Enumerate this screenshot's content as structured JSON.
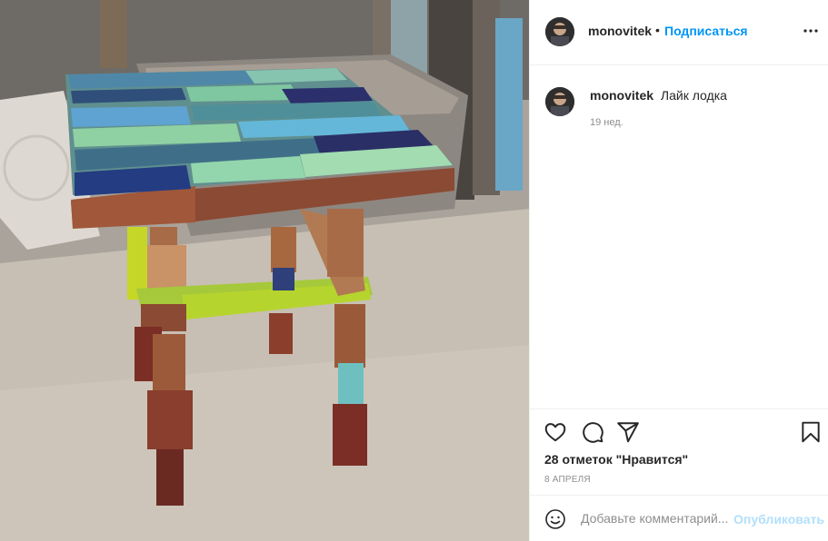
{
  "post": {
    "image_alt": "Table with a multicolored painted wood top and uneven block legs",
    "author": {
      "username": "monovitek",
      "follow_label": "Подписаться",
      "dot": "•"
    },
    "caption": {
      "username": "monovitek",
      "text": "Лайк лодка",
      "time_ago": "19 нед."
    },
    "likes_label": "28 отметок \"Нравится\"",
    "date_label": "8 АПРЕЛЯ",
    "comment": {
      "placeholder": "Добавьте комментарий...",
      "publish_label": "Опубликовать"
    }
  },
  "icons": {
    "more": "more-options-icon",
    "like": "heart-icon",
    "comment": "comment-bubble-icon",
    "share": "paper-plane-icon",
    "save": "bookmark-icon",
    "emoji": "emoji-icon"
  },
  "colors": {
    "link_blue": "#0095f6",
    "publish_disabled": "#b2dffc",
    "muted_text": "#8e8e8e",
    "border": "#efefef"
  }
}
